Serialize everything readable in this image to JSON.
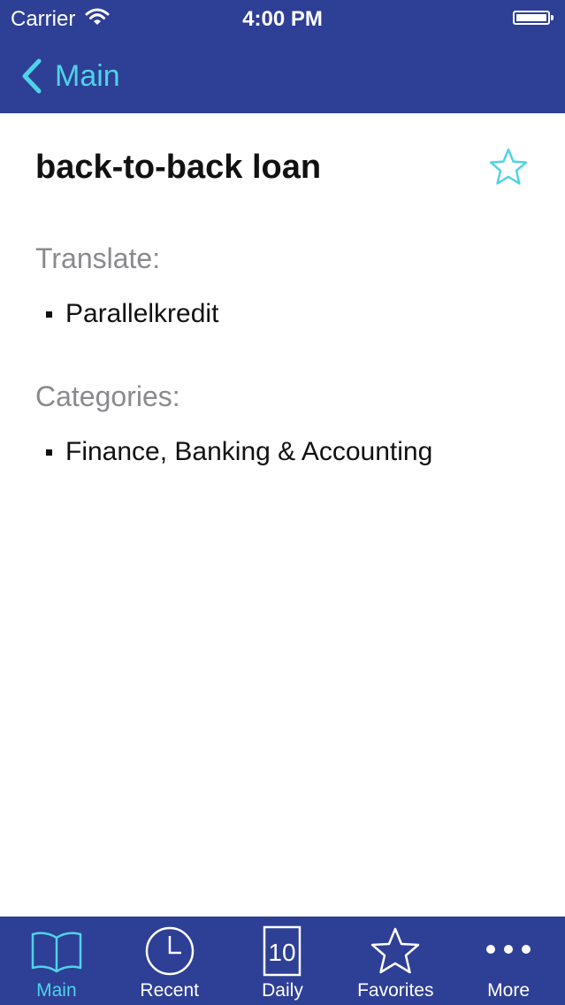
{
  "status_bar": {
    "carrier": "Carrier",
    "time": "4:00 PM"
  },
  "nav": {
    "back_label": "Main"
  },
  "entry": {
    "term": "back-to-back loan",
    "translate_title": "Translate:",
    "translations": [
      "Parallelkredit"
    ],
    "categories_title": "Categories:",
    "categories": [
      "Finance, Banking & Accounting"
    ]
  },
  "tabs": [
    {
      "label": "Main",
      "icon": "book-icon",
      "active": true
    },
    {
      "label": "Recent",
      "icon": "clock-icon",
      "active": false
    },
    {
      "label": "Daily",
      "icon": "calendar-icon",
      "day": "10",
      "active": false
    },
    {
      "label": "Favorites",
      "icon": "star-icon",
      "active": false
    },
    {
      "label": "More",
      "icon": "more-icon",
      "active": false
    }
  ],
  "colors": {
    "bar": "#2e3f96",
    "accent": "#4fd3e6",
    "section": "#8a8a8e"
  }
}
